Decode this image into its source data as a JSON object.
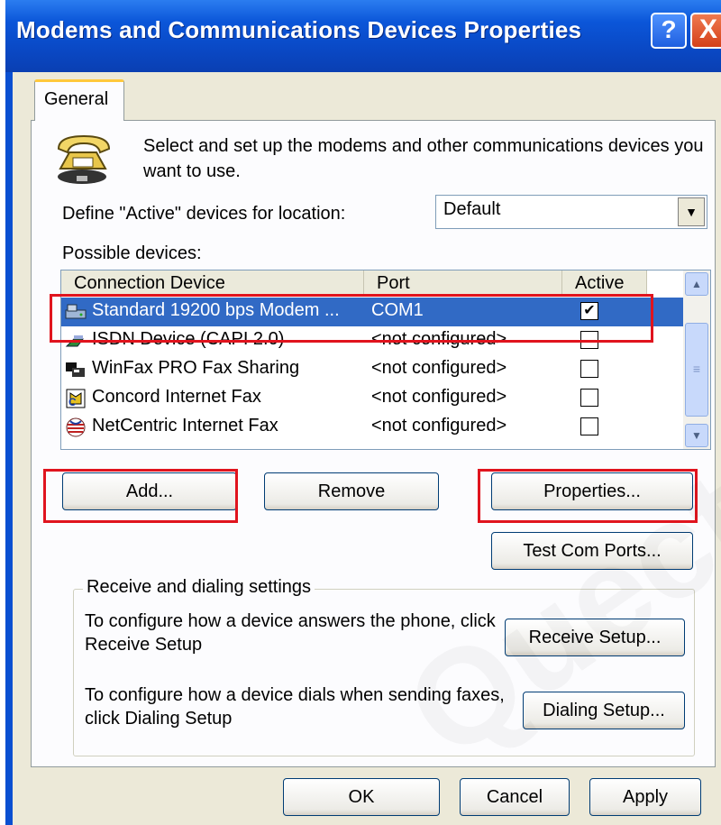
{
  "window": {
    "title": "Modems and Communications Devices Properties",
    "help_label": "?",
    "close_label": "X"
  },
  "tabs": [
    {
      "label": "General"
    }
  ],
  "intro": "Select and set up the modems and other communications devices you want to use.",
  "location": {
    "label": "Define \"Active\" devices for location:",
    "value": "Default"
  },
  "possible_label": "Possible devices:",
  "table": {
    "columns": [
      "Connection Device",
      "Port",
      "Active"
    ],
    "rows": [
      {
        "device": "Standard 19200 bps Modem ...",
        "port": "COM1",
        "active": true,
        "icon": "modem-icon"
      },
      {
        "device": "ISDN Device (CAPI 2.0)",
        "port": "<not configured>",
        "active": false,
        "icon": "isdn-icon"
      },
      {
        "device": "WinFax PRO Fax Sharing",
        "port": "<not configured>",
        "active": false,
        "icon": "winfax-icon"
      },
      {
        "device": "Concord Internet Fax",
        "port": "<not configured>",
        "active": false,
        "icon": "concord-fax-icon"
      },
      {
        "device": "NetCentric Internet Fax",
        "port": "<not configured>",
        "active": false,
        "icon": "netcentric-fax-icon"
      }
    ]
  },
  "buttons": {
    "add": "Add...",
    "remove": "Remove",
    "properties": "Properties...",
    "test": "Test Com Ports...",
    "ok": "OK",
    "cancel": "Cancel",
    "apply": "Apply"
  },
  "receive": {
    "group_title": "Receive and dialing settings",
    "receive_text": "To configure how a device answers the phone, click Receive Setup",
    "receive_button": "Receive Setup...",
    "dial_text": "To configure how a device dials when sending faxes, click Dialing Setup",
    "dial_button": "Dialing Setup..."
  },
  "colors": {
    "title_bar": "#0a4fd1",
    "selection": "#316ac5",
    "highlight_box": "#e0141e",
    "dialog_bg": "#ece9d8"
  }
}
